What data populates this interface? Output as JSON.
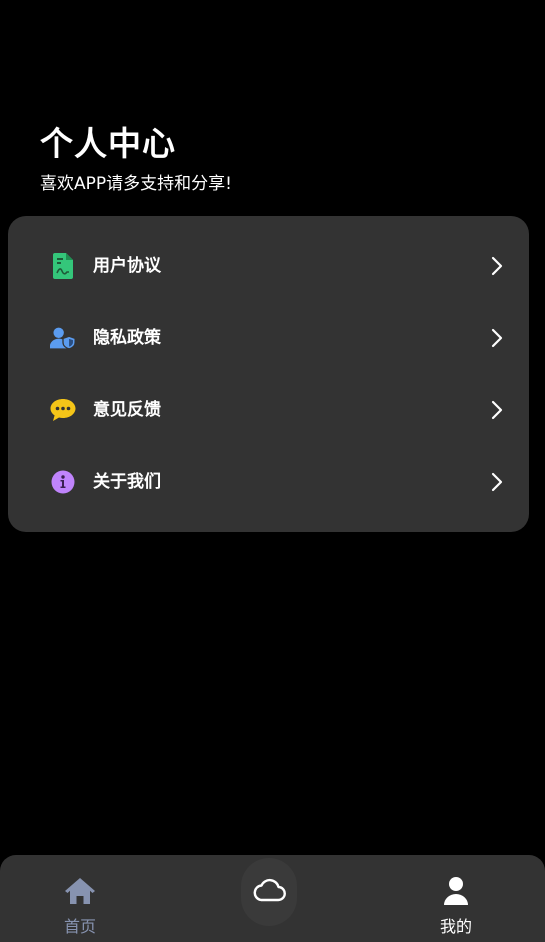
{
  "header": {
    "title": "个人中心",
    "subtitle": "喜欢APP请多支持和分享!"
  },
  "menu": {
    "items": [
      {
        "label": "用户协议",
        "icon": "document-icon",
        "icon_color": "#34c67a"
      },
      {
        "label": "隐私政策",
        "icon": "user-shield-icon",
        "icon_color": "#5b9cf0"
      },
      {
        "label": "意见反馈",
        "icon": "chat-bubble-icon",
        "icon_color": "#f5c518"
      },
      {
        "label": "关于我们",
        "icon": "info-icon",
        "icon_color": "#c084fc"
      }
    ]
  },
  "tabbar": {
    "home_label": "首页",
    "mine_label": "我的",
    "center_icon": "cloud-icon"
  },
  "colors": {
    "background": "#000000",
    "card": "#333333",
    "tab_inactive": "#8793b0",
    "tab_active": "#ffffff"
  }
}
